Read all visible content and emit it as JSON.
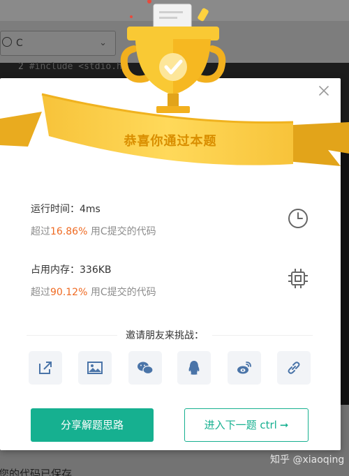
{
  "editor": {
    "language": "C",
    "code_line_number": "2",
    "code_line_text": "#include <stdio.h>",
    "bottom_text": "您的代码已保存"
  },
  "dialog": {
    "title": "恭喜你通过本题",
    "runtime": {
      "label": "运行时间：4ms",
      "beat_prefix": "超过",
      "beat_percent": "16.86%",
      "beat_suffix": "用C提交的代码"
    },
    "memory": {
      "label": "占用内存：336KB",
      "beat_prefix": "超过",
      "beat_percent": "90.12%",
      "beat_suffix": "用C提交的代码"
    },
    "invite_label": "邀请朋友来挑战：",
    "share_icons": [
      "share-link-icon",
      "image-icon",
      "wechat-icon",
      "qq-icon",
      "weibo-icon",
      "link-icon"
    ],
    "share_solution_button": "分享解题思路",
    "next_problem_button": "进入下一题 ctrl",
    "next_arrow": "➞"
  },
  "watermark": "知乎 @xiaoqing",
  "colors": {
    "accent_green": "#16b090",
    "highlight_orange": "#ef6a22",
    "ribbon_gold": "#f5b623",
    "title_gold": "#d98e00"
  }
}
